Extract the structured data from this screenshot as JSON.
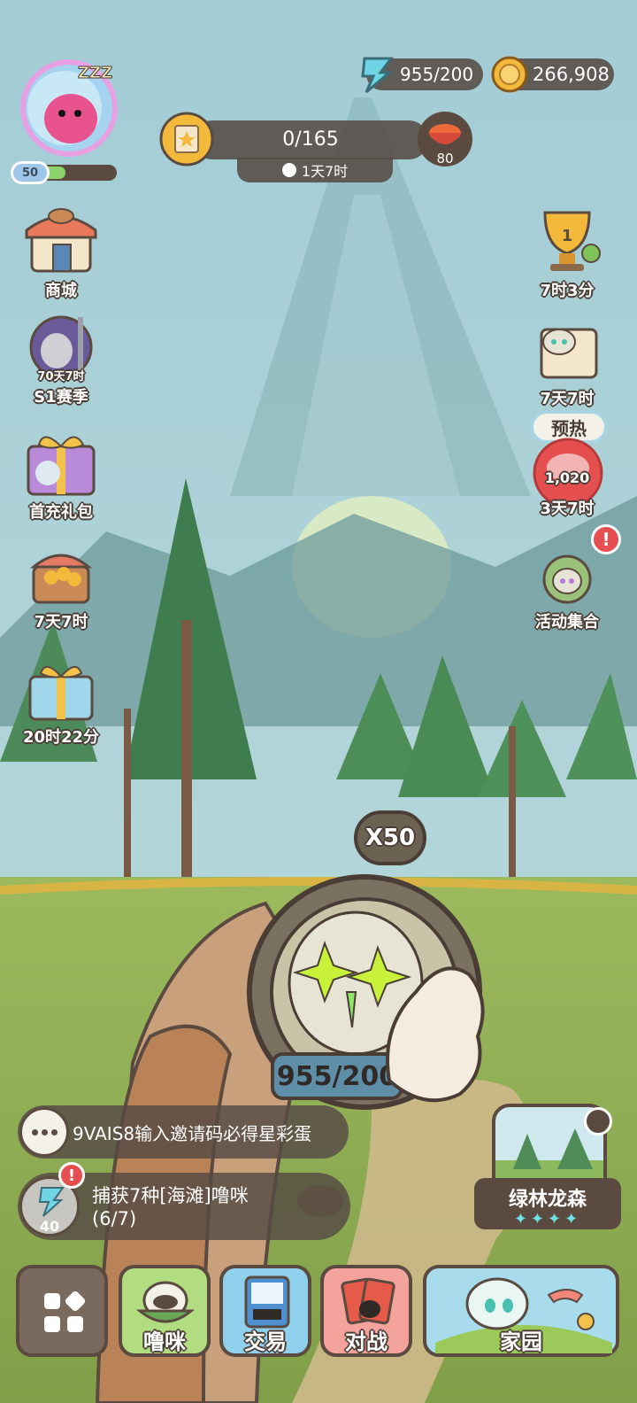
{
  "header": {
    "energy_text": "955/200",
    "coins_text": "266,908",
    "player_level": "50",
    "quest_progress": "0/165",
    "quest_timer": "1天7时",
    "food_count": "80"
  },
  "left_menu": [
    {
      "label": "商城",
      "icon": "shop-icon"
    },
    {
      "label": "S1赛季",
      "sub": "70天7时",
      "icon": "knight-icon"
    },
    {
      "label": "首充礼包",
      "icon": "gift-icon"
    },
    {
      "label": "7天7时",
      "icon": "treasure-chest-icon"
    },
    {
      "label": "20时22分",
      "icon": "present-box-icon"
    }
  ],
  "right_menu": [
    {
      "label": "7时3分",
      "badge": "1",
      "icon": "trophy-icon"
    },
    {
      "label": "7天7时",
      "icon": "map-scroll-icon"
    },
    {
      "label": "3天7时",
      "tag": "预热",
      "value": "1,020",
      "icon": "meat-event-icon"
    },
    {
      "label": "活动集合",
      "icon": "events-wreath-icon"
    }
  ],
  "device": {
    "multiplier": "X50",
    "counter": "955/200"
  },
  "chat": {
    "text": "9VAIS8输入邀请码必得星彩蛋"
  },
  "quest_task": {
    "line1": "捕获7种[海滩]噜咪",
    "line2": "(6/7)",
    "energy_cost": "40"
  },
  "location": {
    "name": "绿林龙森",
    "stars": "✦✦✦✦"
  },
  "bottom_nav": {
    "menu": "",
    "lumi": "噜咪",
    "trade": "交易",
    "battle": "对战",
    "home": "家园"
  },
  "colors": {
    "sky": "#a9cfd6",
    "grass": "#8cab53",
    "panel": "#5a4a40",
    "gold": "#f3b93a",
    "energy": "#6fd4e4"
  }
}
